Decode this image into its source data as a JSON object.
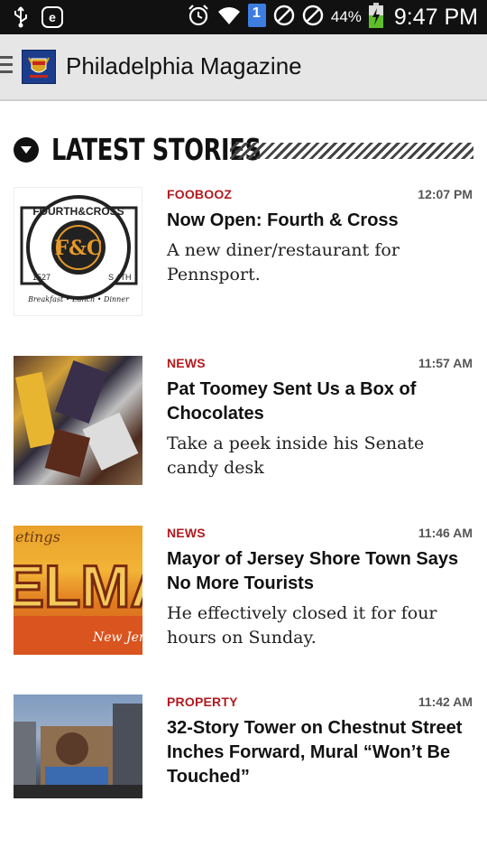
{
  "status_bar": {
    "battery_percent": "44%",
    "time": "9:47 PM",
    "sim_badge": "1",
    "icons": [
      "usb-icon",
      "e-icon",
      "alarm-icon",
      "wifi-icon",
      "sim-icon",
      "blocked-icon",
      "blocked-icon",
      "battery-charging-icon"
    ]
  },
  "app_bar": {
    "title": "Philadelphia Magazine",
    "icons": [
      "hamburger-icon",
      "app-logo"
    ]
  },
  "section": {
    "title": "LATEST STORIES"
  },
  "stories": [
    {
      "category": "FOOBOOZ",
      "time": "12:07 PM",
      "headline": "Now Open: Fourth & Cross",
      "dek": "A new diner/restaurant for Pennsport.",
      "thumb_text": {
        "top": "FOURTH&CROSS",
        "left": "1527",
        "right": "S 4TH",
        "bottom": "Breakfast • Lunch • Dinner",
        "monogram": "F&C"
      }
    },
    {
      "category": "NEWS",
      "time": "11:57 AM",
      "headline": "Pat Toomey Sent Us a Box of Chocolates",
      "dek": "Take a peek inside his Senate candy desk"
    },
    {
      "category": "NEWS",
      "time": "11:46 AM",
      "headline": "Mayor of Jersey Shore Town Says No More Tourists",
      "dek": "He effectively closed it for four hours on Sunday.",
      "thumb_text": {
        "top": "etings",
        "big": "ELMA",
        "bottom": "New Jerse"
      }
    },
    {
      "category": "PROPERTY",
      "time": "11:42 AM",
      "headline": "32-Story Tower on Chestnut Street Inches Forward, Mural “Won’t Be Touched”",
      "dek": ""
    }
  ],
  "colors": {
    "category_red": "#b21a1f",
    "status_bar_bg": "#111111",
    "app_bar_bg": "#e6e6e6"
  }
}
